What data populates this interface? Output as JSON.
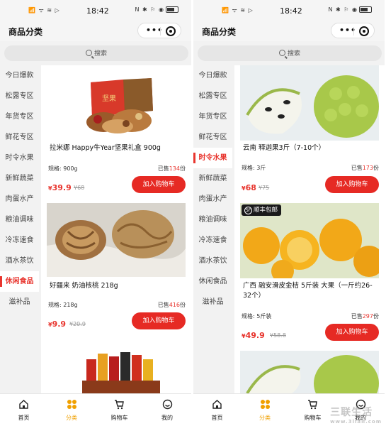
{
  "status_bar": {
    "left_icons": "📶 ᯤ ≋ ▷",
    "time": "18:42",
    "right_icons": "N ✱ ⚐ ◉"
  },
  "header": {
    "title": "商品分类",
    "menu_icon": "more-dots-icon",
    "close_icon": "target-icon"
  },
  "search": {
    "placeholder": "搜索"
  },
  "left_screen": {
    "sidebar": [
      "今日爆款",
      "松露专区",
      "年货专区",
      "鲜花专区",
      "时令水果",
      "新鲜蔬菜",
      "肉蛋水产",
      "粮油调味",
      "冷冻速食",
      "酒水茶饮",
      "休闲食品",
      "滋补品"
    ],
    "active_index": 10,
    "products": [
      {
        "name": "拉米娜 Happy牛Year坚果礼盒 900g",
        "spec": "规格: 900g",
        "sold_prefix": "已售",
        "sold": "134",
        "sold_suffix": "份",
        "currency": "¥",
        "price": "39.9",
        "original_price": "¥68",
        "button": "加入购物车"
      },
      {
        "name": "好疆来 奶油核桃 218g",
        "spec": "规格: 218g",
        "sold_prefix": "已售",
        "sold": "416",
        "sold_suffix": "份",
        "currency": "¥",
        "price": "9.9",
        "original_price": "¥20.9",
        "button": "加入购物车"
      }
    ]
  },
  "right_screen": {
    "sidebar": [
      "今日爆款",
      "松露专区",
      "年货专区",
      "鲜花专区",
      "时令水果",
      "新鲜蔬菜",
      "肉蛋水产",
      "粮油调味",
      "冷冻速食",
      "酒水茶饮",
      "休闲食品",
      "滋补品"
    ],
    "active_index": 4,
    "badge": "顺丰包邮",
    "products": [
      {
        "name": "云南 释迦果3斤（7-10个）",
        "spec": "规格: 3斤",
        "sold_prefix": "已售",
        "sold": "173",
        "sold_suffix": "份",
        "currency": "¥",
        "price": "68",
        "original_price": "¥75",
        "button": "加入购物车"
      },
      {
        "name": "广西 融安滑皮金桔 5斤装 大果（一斤约26-32个）",
        "spec": "规格: 5斤装",
        "sold_prefix": "已售",
        "sold": "297",
        "sold_suffix": "份",
        "currency": "¥",
        "price": "49.9",
        "original_price": "¥58.8",
        "button": "加入购物车"
      }
    ]
  },
  "tabbar": [
    {
      "label": "首页",
      "icon": "home-icon"
    },
    {
      "label": "分类",
      "icon": "category-icon"
    },
    {
      "label": "购物车",
      "icon": "cart-icon"
    },
    {
      "label": "我的",
      "icon": "profile-icon"
    }
  ],
  "tab_active_index": 1,
  "watermark": {
    "text": "三联生活",
    "sub": "www.3lian.com"
  },
  "colors": {
    "accent": "#e8352e",
    "button": "#e62a24",
    "tab_active": "#f0a000"
  }
}
